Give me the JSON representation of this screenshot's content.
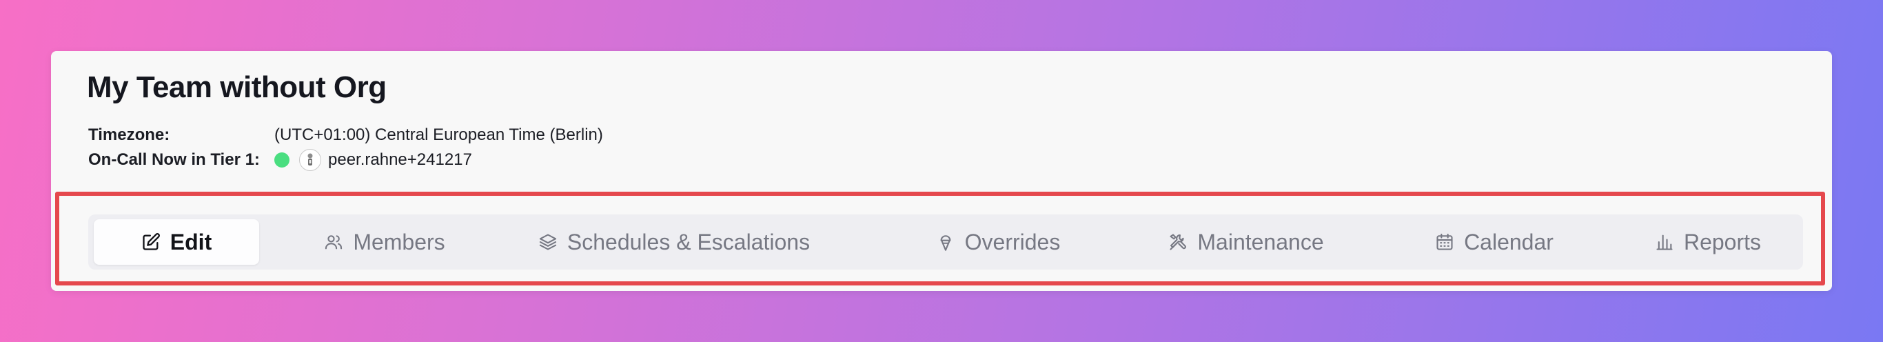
{
  "team": {
    "name": "My Team without Org",
    "timezone_label": "Timezone:",
    "timezone_value": "(UTC+01:00) Central European Time (Berlin)",
    "oncall_label": "On-Call Now in Tier 1:",
    "oncall_user": "peer.rahne+241217",
    "oncall_status_color": "#4ade80"
  },
  "tabs": [
    {
      "label": "Edit",
      "icon": "edit-icon",
      "active": true
    },
    {
      "label": "Members",
      "icon": "users-icon",
      "active": false
    },
    {
      "label": "Schedules & Escalations",
      "icon": "layers-icon",
      "active": false
    },
    {
      "label": "Overrides",
      "icon": "ice-cream-icon",
      "active": false
    },
    {
      "label": "Maintenance",
      "icon": "tools-icon",
      "active": false
    },
    {
      "label": "Calendar",
      "icon": "calendar-icon",
      "active": false
    },
    {
      "label": "Reports",
      "icon": "bar-chart-icon",
      "active": false
    }
  ],
  "highlight_color": "#e5484d"
}
